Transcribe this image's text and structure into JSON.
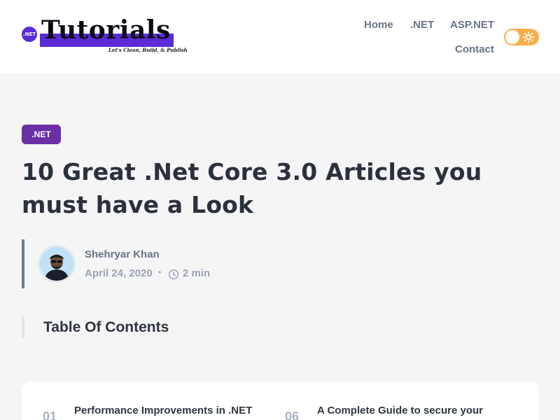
{
  "header": {
    "logo": {
      "badge": ".NET",
      "word": "Tutorials",
      "tagline": "Let's Clean, Build, & Publish",
      "brand_color": "#5b2bd6"
    },
    "nav": {
      "home": "Home",
      "net": ".NET",
      "aspnet": "ASP.NET",
      "contact": "Contact"
    },
    "theme_toggle": {
      "icon": "sun-icon",
      "color": "#f9ae4b"
    }
  },
  "post": {
    "category": ".NET",
    "category_color": "#6b2fa6",
    "title": "10 Great .Net Core 3.0 Articles you must have a Look",
    "author": {
      "name": "Shehryar Khan",
      "avatar_icon": "author-avatar"
    },
    "date": "April 24, 2020",
    "separator": "•",
    "read_time": "2 min"
  },
  "toc": {
    "heading": "Table Of Contents",
    "items": [
      {
        "number": "01",
        "title": "Performance Improvements in .NET"
      },
      {
        "number": "06",
        "title": "A Complete Guide to secure your"
      }
    ]
  }
}
